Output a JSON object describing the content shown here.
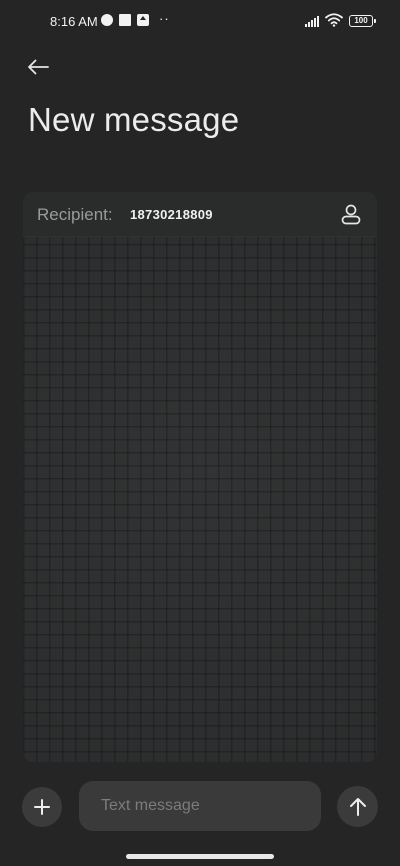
{
  "status_bar": {
    "time": "8:16 AM",
    "overflow_dots": "··",
    "battery": "100"
  },
  "header": {
    "title": "New message"
  },
  "recipient": {
    "label": "Recipient:",
    "value": "18730218809"
  },
  "composer": {
    "placeholder": "Text message"
  },
  "colors": {
    "background": "#252525",
    "card": "#2d2f30",
    "input": "#3a3a3a",
    "button": "#3b3b3b"
  },
  "icons": {
    "back": "arrow-left-icon",
    "contact": "person-icon",
    "add": "plus-icon",
    "send": "arrow-up-icon"
  }
}
